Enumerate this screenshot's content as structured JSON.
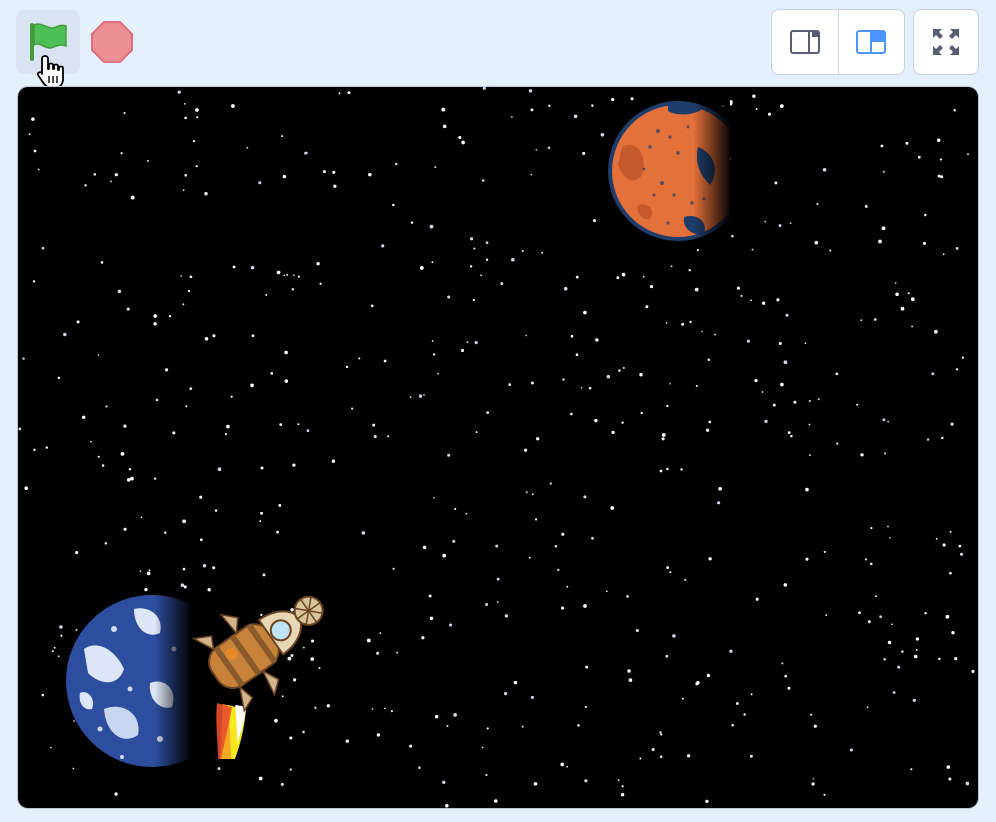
{
  "toolbar": {
    "green_flag_icon": "green-flag-icon",
    "stop_icon": "stop-sign-icon",
    "cursor_icon": "hand-pointer-icon",
    "small_stage_icon": "small-stage-icon",
    "normal_stage_icon": "normal-stage-icon",
    "fullscreen_icon": "fullscreen-icon"
  },
  "stage": {
    "backdrop": "stars",
    "sprites": [
      "planet-mars",
      "planet-earth",
      "rocketship"
    ]
  },
  "colors": {
    "accent_blue": "#4c97ff",
    "flag_green": "#4cbf56",
    "stop_red": "#ec5959",
    "stage_bg": "#000000",
    "mars": "#e4703a",
    "earth": "#2d4e9e"
  }
}
